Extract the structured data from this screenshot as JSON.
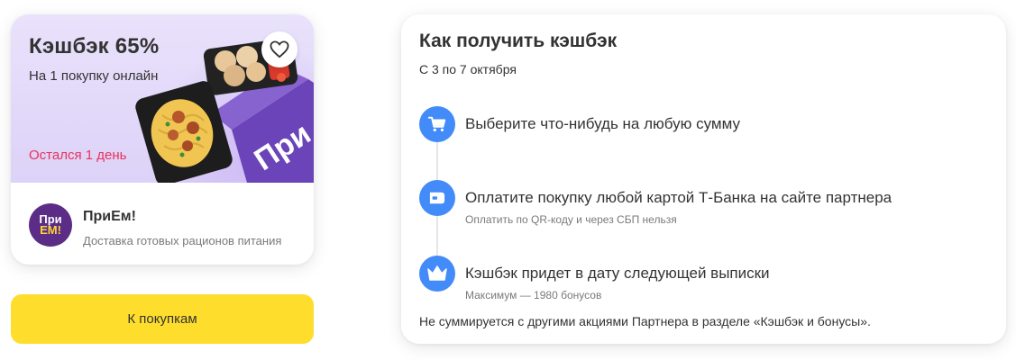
{
  "offer": {
    "title": "Кэшбэк 65%",
    "subtitle": "На 1 покупку онлайн",
    "deadline": "Остался 1 день",
    "brand_box_text": "При",
    "favorite_icon": "heart-icon"
  },
  "merchant": {
    "logo_line1": "При",
    "logo_line2": "ЕМ!",
    "name": "ПриЕм!",
    "description": "Доставка готовых рационов питания"
  },
  "buy_button": {
    "label": "К покупкам"
  },
  "info": {
    "title": "Как получить кэшбэк",
    "period": "С 3 по 7 октября",
    "steps": [
      {
        "icon": "cart-icon",
        "title": "Выберите что-нибудь на любую сумму",
        "note": ""
      },
      {
        "icon": "card-icon",
        "title": "Оплатите покупку любой картой Т-Банка на сайте партнера",
        "note": "Оплатить по QR-коду и через СБП нельзя"
      },
      {
        "icon": "crown-icon",
        "title": "Кэшбэк придет в дату следующей выписки",
        "note": "Максимум — 1980 бонусов"
      }
    ],
    "footnote": "Не суммируется с другими акциями Партнера в разделе «Кэшбэк и бонусы»."
  },
  "colors": {
    "accent_blue": "#428bf9",
    "button_yellow": "#ffdd2d",
    "deadline_red": "#e8325c",
    "banner_purple": "#ddd2f8",
    "brand_purple": "#5b2d86"
  }
}
